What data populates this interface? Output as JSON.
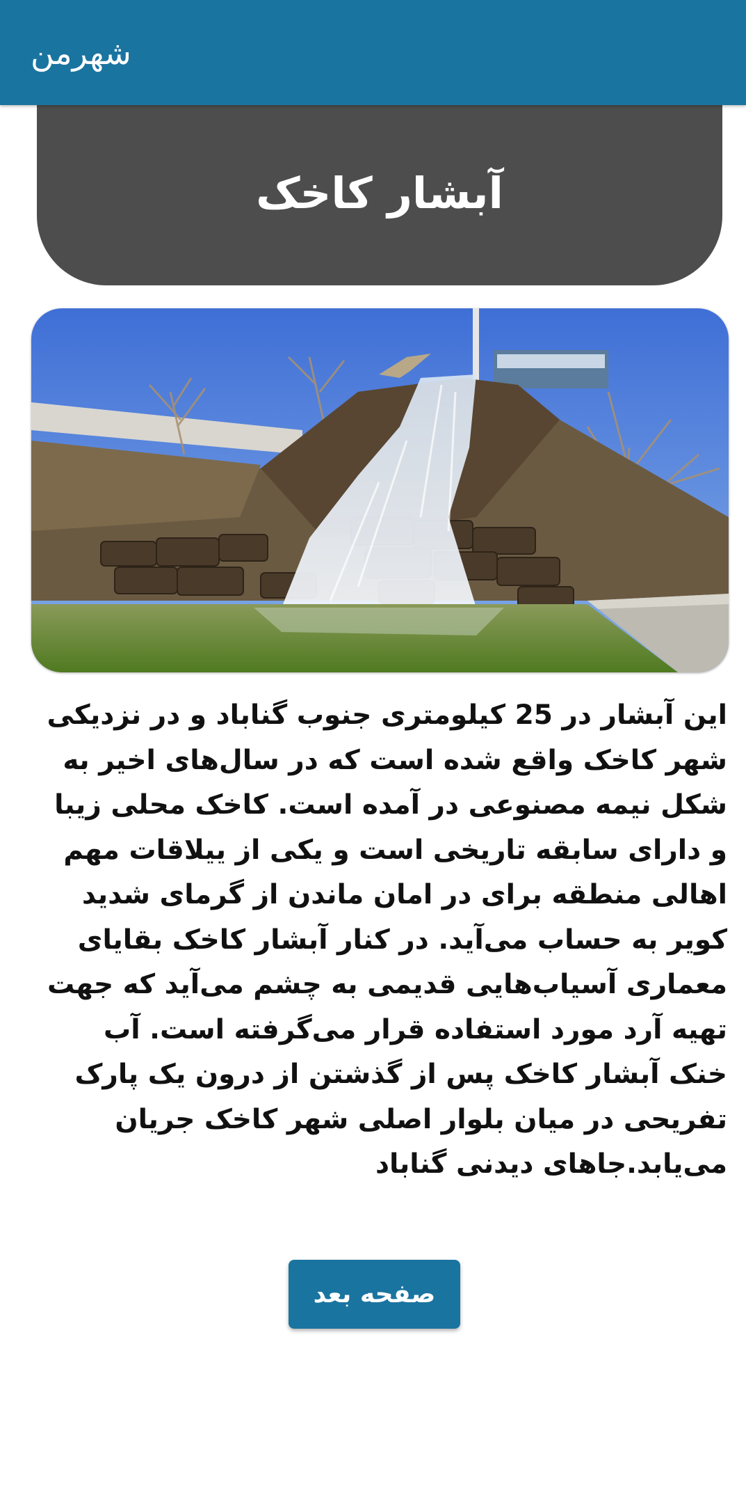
{
  "appbar": {
    "title": "شهرمن",
    "background_color": "#1a74a0"
  },
  "title_card": {
    "title": "آبشار کاخک",
    "background_color": "#4d4d4d"
  },
  "photo": {
    "subject": "waterfall-photo"
  },
  "article": {
    "text": "این آبشار در 25 کیلومتری جنوب گناباد و در نزدیکی شهر کاخک واقع شده است که در سال‌های اخیر به شکل نیمه مصنوعی در آمده است. کاخک محلی زیبا و دارای سابقه تاریخی است و یکی از ییلاقات مهم اهالی منطقه برای در امان ماندن از گرمای شدید کویر به حساب می‌آید. در کنار آبشار کاخک بقایای معماری آسیاب‌هایی قدیمی به چشم می‌آید که جهت تهیه آرد مورد استفاده قرار می‌گرفته است. آب خنک آبشار کاخک پس از گذشتن از درون یک پارک تفریحی در میان بلوار اصلی شهر کاخک جریان می‌یابد.جاهای دیدنی گناباد"
  },
  "navigation": {
    "next_label": "صفحه بعد",
    "accent_color": "#1a74a0"
  }
}
